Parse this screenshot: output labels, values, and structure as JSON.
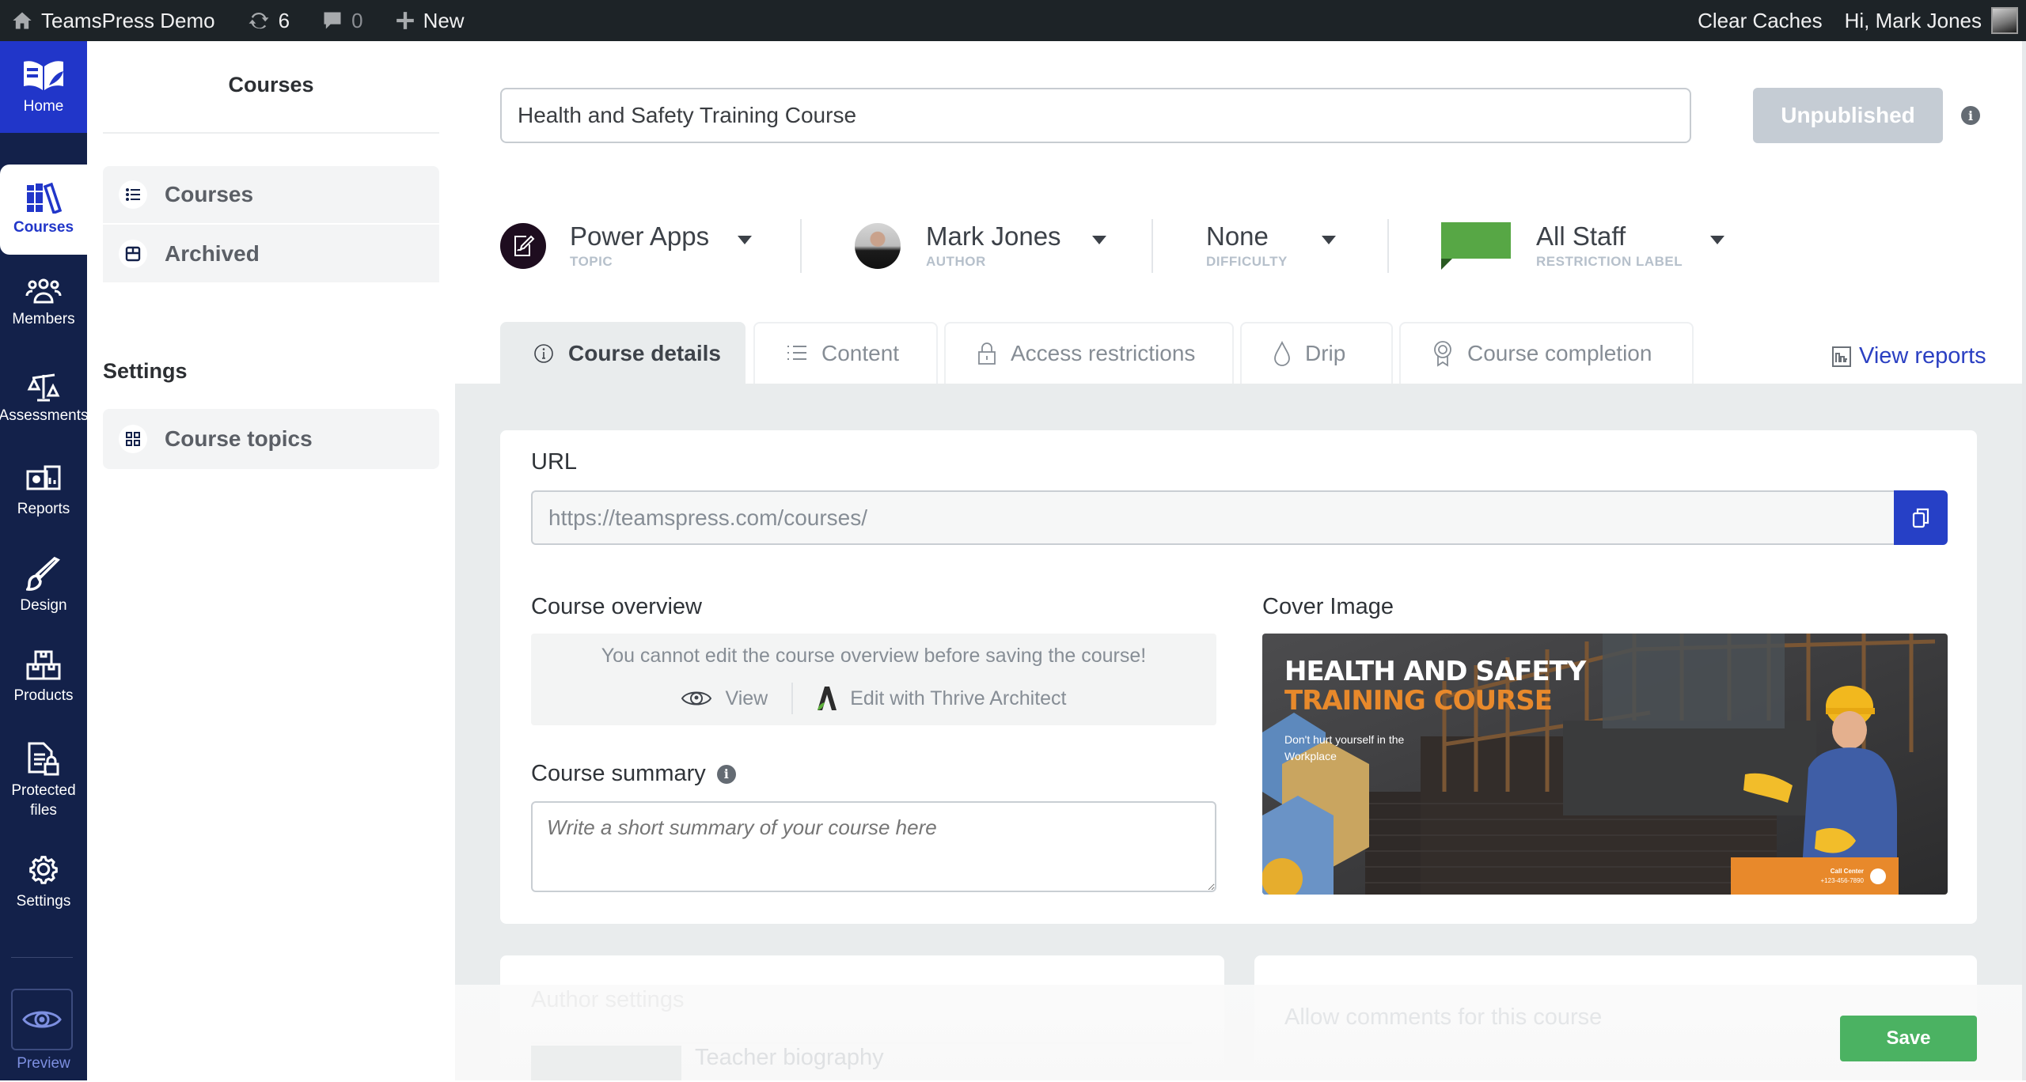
{
  "adminbar": {
    "site_name": "TeamsPress Demo",
    "updates_count": "6",
    "comments_count": "0",
    "new_label": "New",
    "clear_caches": "Clear Caches",
    "greeting": "Hi, Mark Jones"
  },
  "nav": {
    "home": "Home",
    "items": [
      {
        "label": "Courses",
        "icon": "books-icon",
        "active": true
      },
      {
        "label": "Members",
        "icon": "members-icon"
      },
      {
        "label": "Assessments",
        "icon": "scales-icon"
      },
      {
        "label": "Reports",
        "icon": "reports-icon"
      },
      {
        "label": "Design",
        "icon": "brush-icon"
      },
      {
        "label": "Products",
        "icon": "boxes-icon"
      },
      {
        "label": "Protected files",
        "icon": "locked-file-icon"
      },
      {
        "label": "Settings",
        "icon": "gear-icon"
      }
    ],
    "preview": "Preview"
  },
  "sidebar": {
    "title": "Courses",
    "items": [
      {
        "label": "Courses",
        "icon": "list-icon"
      },
      {
        "label": "Archived",
        "icon": "archive-icon"
      }
    ],
    "settings_heading": "Settings",
    "settings_items": [
      {
        "label": "Course topics",
        "icon": "grid-icon"
      }
    ]
  },
  "course": {
    "title": "Health and Safety Training Course",
    "status_button": "Unpublished",
    "meta": {
      "topic": {
        "value": "Power Apps",
        "label": "TOPIC"
      },
      "author": {
        "value": "Mark Jones",
        "label": "AUTHOR"
      },
      "difficulty": {
        "value": "None",
        "label": "DIFFICULTY"
      },
      "restriction": {
        "value": "All Staff",
        "label": "RESTRICTION LABEL",
        "color": "#57a745"
      }
    }
  },
  "tabs": [
    {
      "label": "Course details",
      "icon": "info-icon",
      "active": true
    },
    {
      "label": "Content",
      "icon": "list-icon"
    },
    {
      "label": "Access restrictions",
      "icon": "lock-icon"
    },
    {
      "label": "Drip",
      "icon": "drop-icon"
    },
    {
      "label": "Course completion",
      "icon": "award-icon"
    }
  ],
  "view_reports": "View reports",
  "details": {
    "url_label": "URL",
    "url_value": "https://teamspress.com/courses/",
    "overview_label": "Course overview",
    "overview_message": "You cannot edit the course overview before saving the course!",
    "overview_view": "View",
    "overview_edit": "Edit with Thrive Architect",
    "summary_label": "Course summary",
    "summary_placeholder": "Write a short summary of your course here",
    "cover_label": "Cover Image",
    "cover": {
      "line1": "HEALTH AND SAFETY",
      "line2": "TRAINING COURSE",
      "tagline": "Don't hurt yourself in the Workplace",
      "call_center": "Call Center",
      "phone": "+123-456-7890"
    }
  },
  "lower": {
    "author_settings": "Author settings",
    "teacher_biography": "Teacher biography",
    "allow_comments": "Allow comments for this course"
  },
  "save_label": "Save",
  "colors": {
    "brand_blue": "#2136c9",
    "nav_bg": "#13214a",
    "save_green": "#4bb262",
    "cover_orange": "#e8892b"
  }
}
